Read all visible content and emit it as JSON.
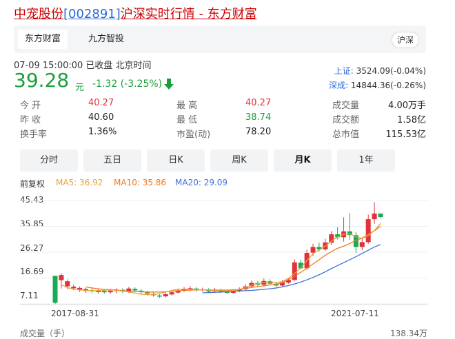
{
  "header": {
    "name": "中宠股份",
    "code": "[002891]",
    "suffix": "沪深实时行情 - 东方财富"
  },
  "tabs": [
    {
      "label": "东方财富",
      "active": true
    },
    {
      "label": "九方智投",
      "active": false
    }
  ],
  "badge": "沪深",
  "status": "07-09 15:00:00  已收盘  北京时间",
  "quote": {
    "price": "39.28",
    "unit": "元",
    "change": "-1.32 (-3.25%)"
  },
  "indices": [
    {
      "label": "上证:",
      "value": "3524.09(-0.04%)"
    },
    {
      "label": "深成:",
      "value": "14844.36(-0.26%)"
    }
  ],
  "stats": [
    [
      {
        "l": "今 开",
        "v": "40.27",
        "c": "red"
      },
      {
        "l": "最 高",
        "v": "40.27",
        "c": "red"
      },
      {
        "l": "成交量",
        "v": "4.00万手",
        "c": "dark"
      }
    ],
    [
      {
        "l": "昨 收",
        "v": "40.60",
        "c": "dark"
      },
      {
        "l": "最 低",
        "v": "38.74",
        "c": "green"
      },
      {
        "l": "成交额",
        "v": "1.58亿",
        "c": "dark"
      }
    ],
    [
      {
        "l": "换手率",
        "v": "1.36%",
        "c": "dark"
      },
      {
        "l": "市盈(动)",
        "v": "78.20",
        "c": "dark"
      },
      {
        "l": "总市值",
        "v": "115.53亿",
        "c": "dark"
      }
    ]
  ],
  "periods": [
    {
      "label": "分时"
    },
    {
      "label": "五日"
    },
    {
      "label": "日K"
    },
    {
      "label": "周K"
    },
    {
      "label": "月K",
      "selected": true
    },
    {
      "label": "1年"
    }
  ],
  "ma": {
    "adj": "前复权",
    "ma5": "MA5: 36.92",
    "ma10": "MA10: 35.86",
    "ma20": "MA20: 29.09"
  },
  "colors": {
    "up": "#e0323a",
    "down": "#1aaa55",
    "ma5": "#e8a33a",
    "ma10": "#f07a22",
    "ma20": "#3f6fd9",
    "link": "#2a6ad6"
  },
  "chart_data": {
    "type": "candlestick",
    "y_ticks": [
      "45.43",
      "35.85",
      "26.27",
      "16.69",
      "7.11"
    ],
    "x_ticks": [
      "2017-08-31",
      "2021-07-11"
    ],
    "ylim": [
      7.11,
      45.43
    ],
    "candles": [
      [
        17.5,
        7.5,
        17.5,
        7.1
      ],
      [
        15.9,
        17.8,
        18.5,
        12.8
      ],
      [
        13.6,
        15.5,
        16.2,
        12.5
      ],
      [
        12.9,
        13.5,
        14.2,
        12.2
      ],
      [
        12.4,
        13.0,
        13.6,
        11.5
      ],
      [
        11.9,
        12.6,
        13.1,
        11.2
      ],
      [
        12.2,
        11.8,
        12.8,
        11.0
      ],
      [
        11.5,
        12.1,
        12.8,
        10.9
      ],
      [
        11.9,
        11.4,
        12.4,
        10.8
      ],
      [
        11.4,
        12.0,
        12.7,
        10.8
      ],
      [
        11.9,
        12.4,
        12.9,
        11.0
      ],
      [
        12.3,
        11.7,
        12.9,
        11.1
      ],
      [
        11.6,
        12.8,
        13.4,
        11.2
      ],
      [
        12.7,
        12.1,
        13.2,
        11.4
      ],
      [
        12.0,
        11.5,
        12.6,
        10.8
      ],
      [
        11.4,
        10.9,
        11.9,
        10.2
      ],
      [
        10.8,
        10.3,
        11.4,
        9.8
      ],
      [
        10.2,
        9.8,
        10.7,
        9.3
      ],
      [
        9.9,
        10.7,
        11.3,
        9.5
      ],
      [
        10.6,
        11.4,
        11.9,
        10.2
      ],
      [
        11.3,
        12.1,
        12.8,
        10.9
      ],
      [
        12.0,
        12.6,
        13.3,
        11.5
      ],
      [
        12.5,
        12.9,
        13.7,
        11.8
      ],
      [
        12.8,
        12.2,
        13.3,
        11.6
      ],
      [
        12.1,
        12.5,
        13.1,
        11.6
      ],
      [
        12.4,
        11.7,
        12.9,
        11.3
      ],
      [
        11.8,
        12.4,
        13.0,
        11.4
      ],
      [
        12.3,
        11.6,
        12.8,
        11.1
      ],
      [
        11.7,
        11.2,
        12.3,
        10.7
      ],
      [
        11.2,
        11.8,
        12.4,
        10.8
      ],
      [
        11.8,
        12.5,
        13.2,
        11.4
      ],
      [
        12.5,
        13.6,
        14.4,
        12.1
      ],
      [
        13.6,
        14.9,
        15.8,
        13.0
      ],
      [
        14.8,
        14.2,
        15.6,
        13.5
      ],
      [
        14.2,
        15.6,
        16.5,
        13.8
      ],
      [
        15.5,
        14.6,
        16.2,
        14.0
      ],
      [
        14.6,
        13.9,
        15.1,
        13.4
      ],
      [
        13.9,
        15.1,
        15.9,
        13.5
      ],
      [
        15.0,
        16.0,
        16.8,
        14.6
      ],
      [
        16.0,
        22.5,
        23.6,
        15.6
      ],
      [
        22.4,
        20.3,
        23.5,
        19.8
      ],
      [
        20.3,
        26.0,
        27.2,
        19.9
      ],
      [
        26.1,
        28.2,
        29.4,
        24.9
      ],
      [
        28.2,
        27.3,
        29.8,
        26.5
      ],
      [
        27.3,
        29.9,
        31.2,
        26.8
      ],
      [
        29.8,
        32.9,
        34.1,
        28.9
      ],
      [
        32.9,
        31.8,
        35.5,
        31.0
      ],
      [
        31.8,
        34.0,
        39.2,
        30.2
      ],
      [
        34.0,
        32.6,
        40.8,
        30.9
      ],
      [
        32.6,
        28.2,
        33.8,
        26.0
      ],
      [
        28.2,
        30.0,
        31.5,
        27.0
      ],
      [
        30.0,
        38.5,
        40.2,
        29.4
      ],
      [
        38.5,
        40.6,
        44.8,
        36.8
      ],
      [
        40.6,
        39.28,
        40.27,
        38.74
      ]
    ],
    "ma5": [
      14.2,
      13.1,
      12.6,
      12.3,
      12.1,
      12.0,
      12.0,
      12.2,
      12.3,
      12.2,
      11.9,
      11.5,
      11.1,
      10.7,
      10.5,
      10.6,
      10.9,
      11.5,
      12.1,
      12.5,
      12.6,
      12.5,
      12.4,
      12.3,
      12.2,
      12.1,
      12.0,
      11.9,
      12.0,
      12.4,
      13.2,
      14.0,
      14.6,
      15.0,
      15.2,
      15.1,
      15.3,
      16.6,
      18.4,
      20.5,
      23.1,
      25.7,
      27.1,
      28.5,
      30.4,
      31.9,
      32.9,
      33.1,
      32.0,
      31.4,
      32.4,
      34.3,
      36.92
    ],
    "ma10": [
      13.4,
      13.0,
      12.7,
      12.5,
      12.4,
      12.2,
      12.0,
      11.8,
      11.7,
      11.6,
      11.5,
      11.5,
      11.5,
      11.6,
      11.8,
      12.0,
      12.1,
      12.2,
      12.3,
      12.3,
      12.3,
      12.2,
      12.2,
      12.2,
      12.3,
      12.5,
      12.8,
      13.2,
      13.5,
      13.8,
      14.1,
      14.4,
      15.0,
      16.1,
      17.4,
      18.8,
      20.3,
      21.9,
      23.5,
      25.1,
      26.5,
      27.7,
      28.5,
      29.5,
      30.6,
      31.5,
      32.9,
      34.2,
      35.86
    ],
    "ma20": [
      11.2,
      11.3,
      11.4,
      11.5,
      11.6,
      11.8,
      11.9,
      12.0,
      12.1,
      12.3,
      12.5,
      12.7,
      13.0,
      13.4,
      13.9,
      14.5,
      15.2,
      16.0,
      16.9,
      17.9,
      19.0,
      20.2,
      21.3,
      22.4,
      23.5,
      24.6,
      25.8,
      27.0,
      28.2,
      29.09
    ]
  },
  "volume": {
    "label": "成交量（手）",
    "max": "138.34万"
  }
}
